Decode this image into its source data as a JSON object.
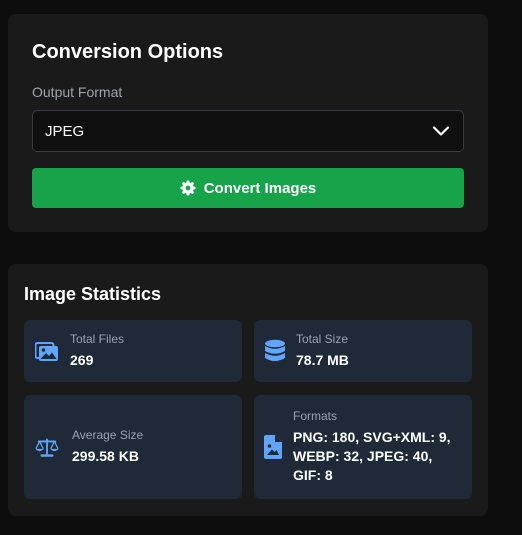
{
  "conversion_options": {
    "title": "Conversion Options",
    "output_format_label": "Output Format",
    "output_format_value": "JPEG",
    "convert_button_label": "Convert Images"
  },
  "image_statistics": {
    "title": "Image Statistics",
    "total_files": {
      "label": "Total Files",
      "value": "269",
      "icon": "images-icon"
    },
    "total_size": {
      "label": "Total Size",
      "value": "78.7 MB",
      "icon": "database-icon"
    },
    "average_size": {
      "label": "Average Size",
      "value": "299.58 KB",
      "icon": "balance-scale-icon"
    },
    "formats": {
      "label": "Formats",
      "value": "PNG: 180, SVG+XML: 9, WEBP: 32, JPEG: 40, GIF: 8",
      "icon": "file-image-icon"
    }
  },
  "colors": {
    "background": "#0d0d0e",
    "panel": "#1a1a1b",
    "card": "#1f2937",
    "accent_green": "#16a34a",
    "icon_blue": "#60a5fa",
    "muted_text": "#9ca3af"
  }
}
